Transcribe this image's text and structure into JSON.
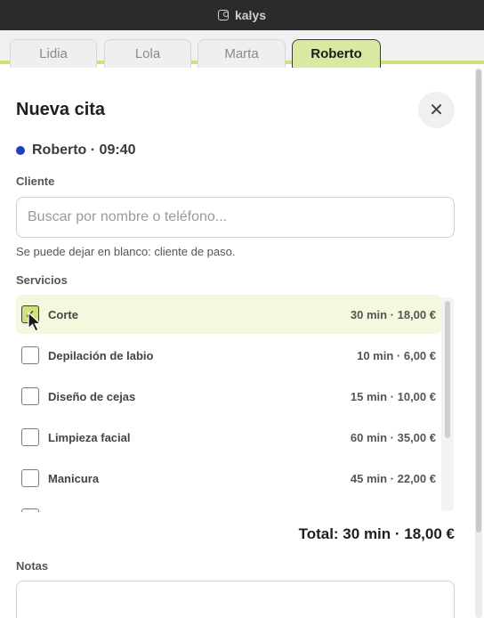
{
  "window": {
    "title": "kalys"
  },
  "tabs": [
    {
      "label": "Lidia",
      "active": false
    },
    {
      "label": "Lola",
      "active": false
    },
    {
      "label": "Marta",
      "active": false
    },
    {
      "label": "Roberto",
      "active": true
    }
  ],
  "dialog": {
    "title": "Nueva cita",
    "close_icon": "close-icon",
    "slot": {
      "text": "Roberto · 09:40",
      "dot_color": "#1f3fbf"
    },
    "client": {
      "label": "Cliente",
      "placeholder": "Buscar por nombre o teléfono...",
      "value": "",
      "hint": "Se puede dejar en blanco: cliente de paso."
    },
    "services": {
      "label": "Servicios",
      "items": [
        {
          "name": "Corte",
          "meta": "30 min · 18,00 €",
          "checked": true
        },
        {
          "name": "Depilación de labio",
          "meta": "10 min · 6,00 €",
          "checked": false
        },
        {
          "name": "Diseño de cejas",
          "meta": "15 min · 10,00 €",
          "checked": false
        },
        {
          "name": "Limpieza facial",
          "meta": "60 min · 35,00 €",
          "checked": false
        },
        {
          "name": "Manicura",
          "meta": "45 min · 22,00 €",
          "checked": false
        }
      ]
    },
    "total": "Total: 30 min · 18,00 €",
    "notes": {
      "label": "Notas",
      "value": ""
    }
  },
  "colors": {
    "accent": "#cde37a",
    "active_tab_bg": "#d9e9a2",
    "titlebar": "#2b2b2b"
  }
}
